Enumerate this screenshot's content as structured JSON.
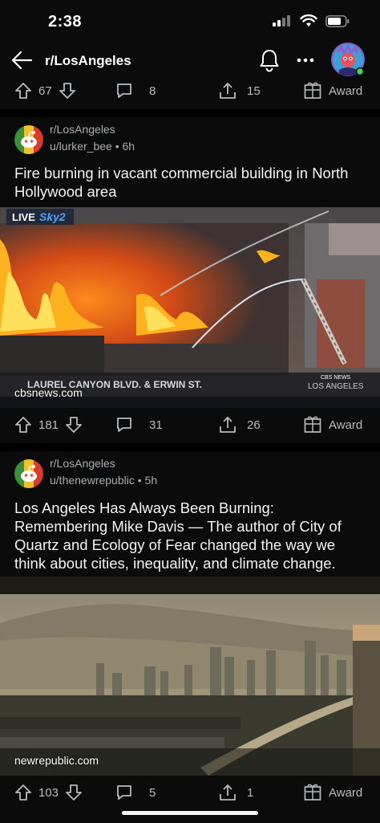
{
  "status_bar": {
    "time": "2:38"
  },
  "header": {
    "title": "r/LosAngeles"
  },
  "prev_post": {
    "upvotes": "67",
    "comments": "8",
    "shares": "15",
    "award_label": "Award"
  },
  "post1": {
    "subreddit": "r/LosAngeles",
    "user_line": "u/lurker_bee • 6h",
    "title": "Fire burning in vacant commercial building in North Hollywood area",
    "image": {
      "live_label": "LIVE",
      "channel_label": "Sky2",
      "location_banner": "LAUREL CANYON BLVD. & ERWIN ST.",
      "station_top": "CBS NEWS",
      "station_bottom": "LOS ANGELES",
      "domain": "cbsnews.com"
    },
    "upvotes": "181",
    "comments": "31",
    "shares": "26",
    "award_label": "Award"
  },
  "post2": {
    "subreddit": "r/LosAngeles",
    "user_line": "u/thenewrepublic • 5h",
    "title": "Los Angeles Has Always Been Burning: Remembering Mike Davis — The author of City of Quartz and Ecology of Fear changed the way we think about cities, inequality, and climate change.",
    "image": {
      "domain": "newrepublic.com"
    },
    "upvotes": "103",
    "comments": "5",
    "shares": "1",
    "award_label": "Award"
  },
  "colors": {
    "background": "#0b0b0b",
    "text": "#d7dadc",
    "meta": "#a9acae",
    "divider": "#000000"
  },
  "icons": [
    "back-arrow-icon",
    "bell-icon",
    "more-icon",
    "upvote-icon",
    "downvote-icon",
    "comment-icon",
    "share-icon",
    "award-icon"
  ]
}
